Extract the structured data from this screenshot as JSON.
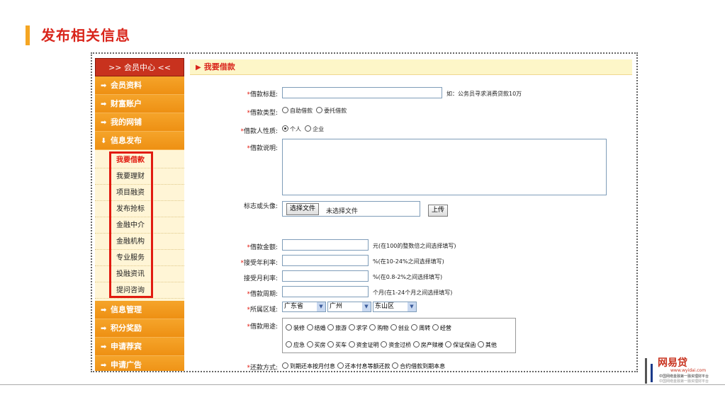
{
  "slide": {
    "title": "发布相关信息"
  },
  "sidebar": {
    "header": ">> 会员中心 <<",
    "items_top": [
      {
        "label": "会员资料",
        "arrow": "➡"
      },
      {
        "label": "财富账户",
        "arrow": "➡"
      },
      {
        "label": "我的网铺",
        "arrow": "➡"
      },
      {
        "label": "信息发布",
        "arrow": "⬇"
      }
    ],
    "subitems": [
      "我要借款",
      "我要理财",
      "项目融资",
      "发布抢标",
      "金融中介",
      "金融机构",
      "专业服务",
      "投融资讯",
      "提问咨询"
    ],
    "items_bottom": [
      {
        "label": "信息管理",
        "arrow": "➡"
      },
      {
        "label": "积分奖励",
        "arrow": "➡"
      },
      {
        "label": "申请荐宾",
        "arrow": "➡"
      },
      {
        "label": "申请广告",
        "arrow": "➡"
      }
    ]
  },
  "content": {
    "header": "我要借款",
    "header_icon": "▶",
    "required_mark": "*",
    "title_label": "借款标题:",
    "title_hint": "如：公务员寻求消费贷款10万",
    "type_label": "借款类型:",
    "type_options": [
      "自助借款",
      "委托借款"
    ],
    "nature_label": "借款人性质:",
    "nature_options": [
      "个人",
      "企业"
    ],
    "desc_label": "借款说明:",
    "logo_label": "标志或头像:",
    "file_button": "选择文件",
    "file_status": "未选择文件",
    "upload_button": "上传",
    "amount_label": "借款金额:",
    "amount_hint": "元(在100的整数倍之间选择填写)",
    "annual_label": "接受年利率:",
    "annual_hint": "%(在10-24%之间选择填写)",
    "monthly_label": "接受月利率:",
    "monthly_hint": "%(在0.8-2%之间选择填写)",
    "period_label": "借款周期:",
    "period_hint": "个月(在1-24个月之间选择填写)",
    "region_label": "所属区域:",
    "region_values": [
      "广东省",
      "广州",
      "东山区"
    ],
    "purpose_label": "借款用途:",
    "purpose_row1": [
      "装修",
      "结婚",
      "旅游",
      "求学",
      "购物",
      "创业",
      "周转",
      "经营"
    ],
    "purpose_row2": [
      "应急",
      "买房",
      "买车",
      "资金证明",
      "资金过桥",
      "房产赎楼",
      "保证保函",
      "其他"
    ],
    "repay_label": "还款方式:",
    "repay_options": [
      "到期还本按月付息",
      "还本付息等额还款",
      "合约借款到期本息"
    ]
  },
  "logo": {
    "brand": "网易贷",
    "url": "www.wyidai.com",
    "tagline": "中国网络金融第一融资理财平台",
    "tagline2": "中国网络金融第一融资理财平台"
  },
  "colors": {
    "accent": "#f5a623",
    "title": "#d9261c",
    "sidebar": "#f09a1a",
    "highlight": "#e11b10"
  }
}
